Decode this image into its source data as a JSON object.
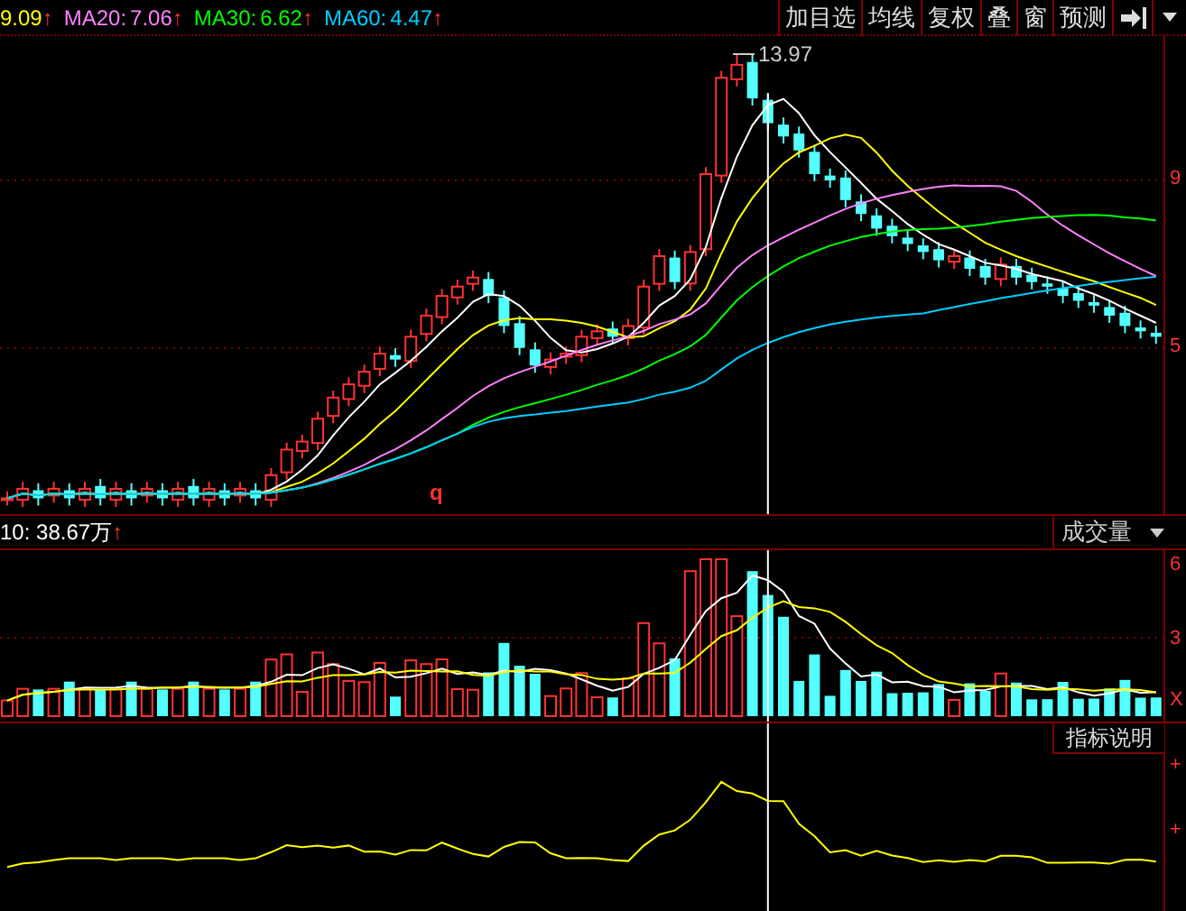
{
  "ma_legend": [
    {
      "value": "9.09",
      "arrow": "↑",
      "color": "#ffff00"
    },
    {
      "label": "MA20:",
      "value": "7.06",
      "arrow": "↑",
      "color": "#ff80ff"
    },
    {
      "label": "MA30:",
      "value": "6.62",
      "arrow": "↑",
      "color": "#00ff00"
    },
    {
      "label": "MA60:",
      "value": "4.47",
      "arrow": "↑",
      "color": "#00ccff"
    }
  ],
  "toolbar": [
    "加目选",
    "均线",
    "复权",
    "叠",
    "窗",
    "预测"
  ],
  "price_panel": {
    "high_label": "13.97",
    "marker": "q",
    "axis_labels": [
      "9",
      "5"
    ]
  },
  "volume_header": {
    "value": "10: 38.67万",
    "arrow": "↑",
    "indicator": "成交量"
  },
  "volume_panel": {
    "axis_labels": [
      "6",
      "3",
      "X"
    ]
  },
  "indicator_panel": {
    "button": "指标说明",
    "axis_labels": [
      "+",
      "+"
    ]
  }
}
